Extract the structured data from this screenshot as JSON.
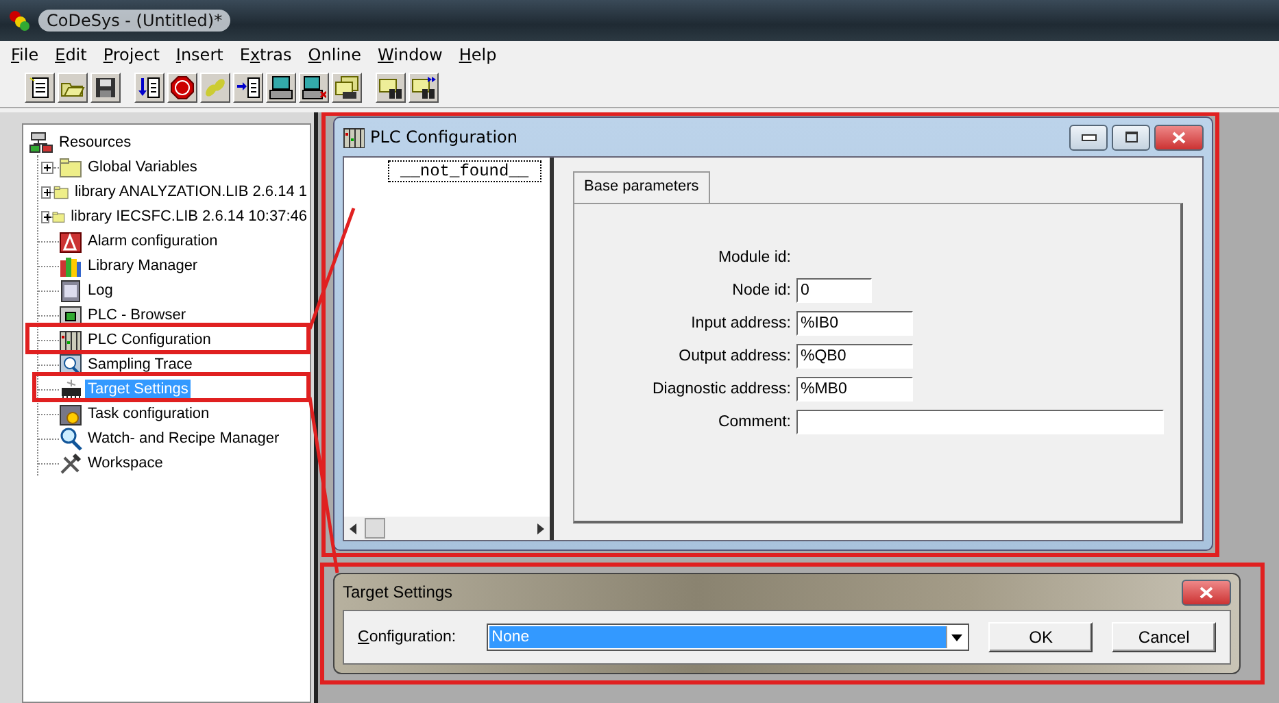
{
  "window": {
    "title": "CoDeSys - (Untitled)*"
  },
  "menu": [
    {
      "label": "File"
    },
    {
      "label": "Edit"
    },
    {
      "label": "Project"
    },
    {
      "label": "Insert"
    },
    {
      "label": "Extras"
    },
    {
      "label": "Online"
    },
    {
      "label": "Window"
    },
    {
      "label": "Help"
    }
  ],
  "resources": {
    "label": "Resources",
    "children": [
      {
        "label": "Global Variables",
        "expandable": true,
        "selected": false
      },
      {
        "label": "library ANALYZATION.LIB 2.6.14 1",
        "expandable": true,
        "selected": false
      },
      {
        "label": "library IECSFC.LIB 2.6.14 10:37:46",
        "expandable": true,
        "selected": false
      },
      {
        "label": "Alarm configuration",
        "expandable": false,
        "selected": false
      },
      {
        "label": "Library Manager",
        "expandable": false,
        "selected": false
      },
      {
        "label": "Log",
        "expandable": false,
        "selected": false
      },
      {
        "label": "PLC - Browser",
        "expandable": false,
        "selected": false
      },
      {
        "label": "PLC Configuration",
        "expandable": false,
        "selected": false
      },
      {
        "label": "Sampling Trace",
        "expandable": false,
        "selected": false
      },
      {
        "label": "Target Settings",
        "expandable": false,
        "selected": true
      },
      {
        "label": "Task configuration",
        "expandable": false,
        "selected": false
      },
      {
        "label": "Watch- and Recipe Manager",
        "expandable": false,
        "selected": false
      },
      {
        "label": "Workspace",
        "expandable": false,
        "selected": false
      }
    ]
  },
  "plc_configuration": {
    "title": "PLC Configuration",
    "tree_item": "__not_found__",
    "tabs": [
      {
        "label": "Base parameters",
        "selected": true
      }
    ],
    "fields": [
      {
        "label": "Module id:",
        "kind": "text"
      },
      {
        "label": "Node id:",
        "kind": "short",
        "value": "0"
      },
      {
        "label": "Input address:",
        "kind": "medium",
        "value": "%IB0"
      },
      {
        "label": "Output address:",
        "kind": "medium",
        "value": "%QB0"
      },
      {
        "label": "Diagnostic address:",
        "kind": "medium",
        "value": "%MB0"
      },
      {
        "label": "Comment:",
        "kind": "long"
      }
    ]
  },
  "target_settings": {
    "title": "Target Settings",
    "label": "Configuration:",
    "value": "None",
    "buttons": [
      "OK",
      "Cancel"
    ]
  }
}
